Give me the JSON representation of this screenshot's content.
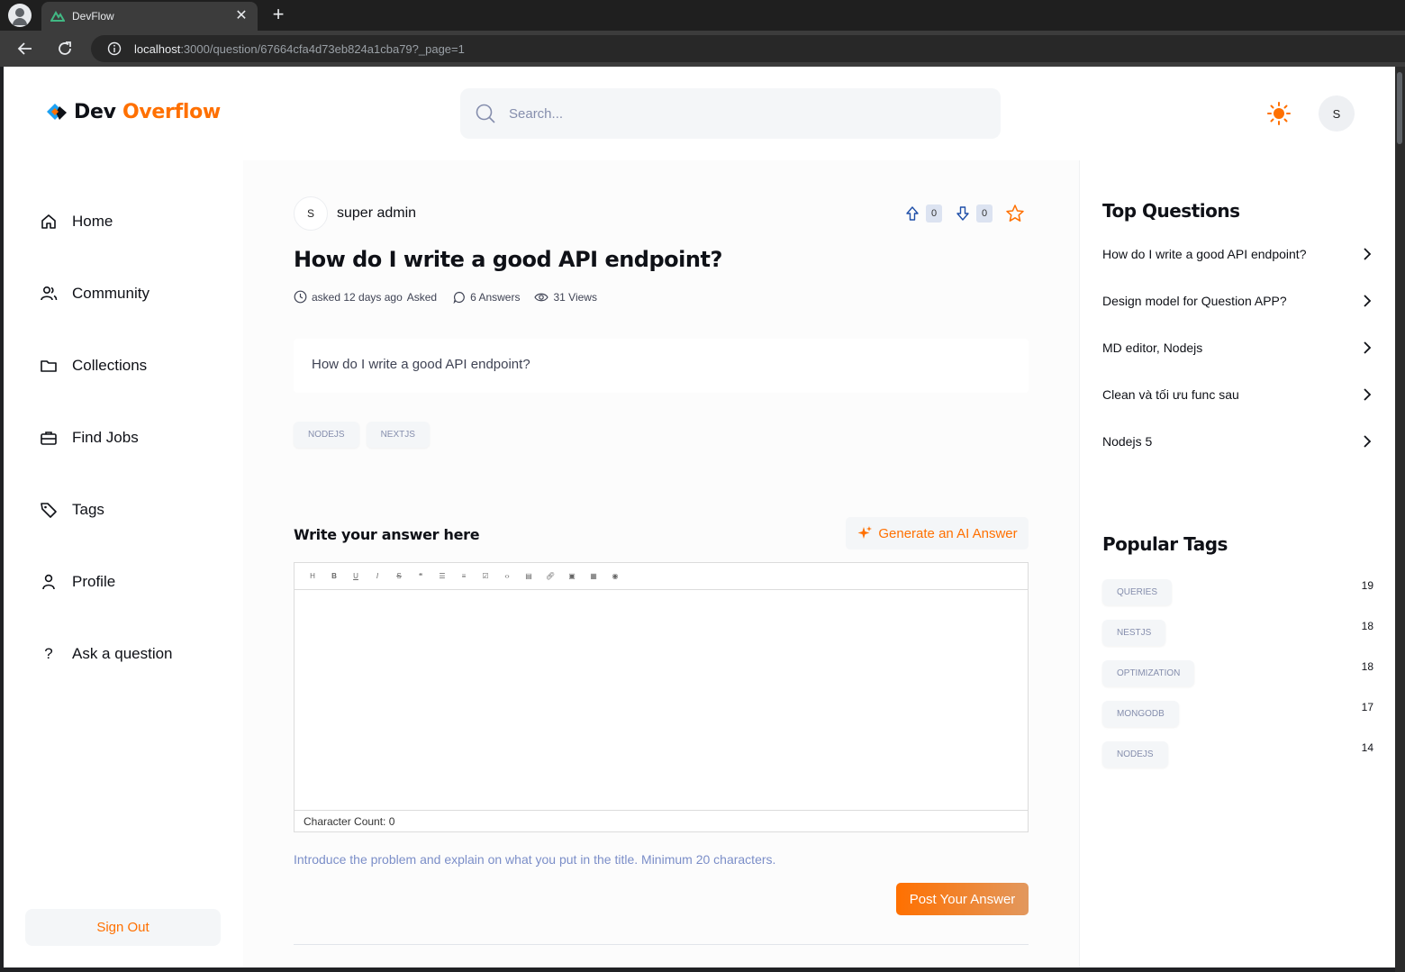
{
  "browser": {
    "tab_title": "DevFlow",
    "url_host": "localhost",
    "url_rest": ":3000/question/67664cfa4d73eb824a1cba79?_page=1"
  },
  "header": {
    "logo_part1": "Dev",
    "logo_part2": "Overflow",
    "search_placeholder": "Search...",
    "user_initial": "S"
  },
  "sidebar": {
    "items": [
      {
        "label": "Home",
        "icon": "home-icon"
      },
      {
        "label": "Community",
        "icon": "users-icon"
      },
      {
        "label": "Collections",
        "icon": "folder-icon"
      },
      {
        "label": "Find Jobs",
        "icon": "briefcase-icon"
      },
      {
        "label": "Tags",
        "icon": "tag-icon"
      },
      {
        "label": "Profile",
        "icon": "user-icon"
      },
      {
        "label": "Ask a question",
        "icon": "question-icon"
      }
    ],
    "sign_out": "Sign Out"
  },
  "question": {
    "author_initial": "S",
    "author_name": "super admin",
    "upvotes": "0",
    "downvotes": "0",
    "title": "How do I write a good API endpoint?",
    "asked": "asked 12 days ago",
    "asked_label": "Asked",
    "answers": "6 Answers",
    "views": "31 Views",
    "body": "How do I write a good API endpoint?",
    "tags": [
      "NODEJS",
      "NEXTJS"
    ]
  },
  "answer_form": {
    "label": "Write your answer here",
    "ai_button": "Generate an AI Answer",
    "toolbar_buttons": [
      "H",
      "B",
      "U",
      "I",
      "S",
      "66",
      "ul",
      "ol",
      "todo",
      "<>",
      "code",
      "link",
      "img",
      "table",
      "eye"
    ],
    "char_count_label": "Character Count:",
    "char_count": "0",
    "hint": "Introduce the problem and explain on what you put in the title. Minimum 20 characters.",
    "submit": "Post Your Answer"
  },
  "right_sidebar": {
    "top_questions_title": "Top Questions",
    "top_questions": [
      "How do I write a good API endpoint?",
      "Design model for Question APP?",
      "MD editor, Nodejs",
      "Clean và tối ưu func sau",
      "Nodejs 5"
    ],
    "popular_tags_title": "Popular Tags",
    "popular_tags": [
      {
        "name": "QUERIES",
        "count": "19"
      },
      {
        "name": "NESTJS",
        "count": "18"
      },
      {
        "name": "OPTIMIZATION",
        "count": "18"
      },
      {
        "name": "MONGODB",
        "count": "17"
      },
      {
        "name": "NODEJS",
        "count": "14"
      }
    ]
  },
  "colors": {
    "accent": "#ff7000",
    "text_dark": "#0f1117",
    "muted": "#858ead"
  }
}
